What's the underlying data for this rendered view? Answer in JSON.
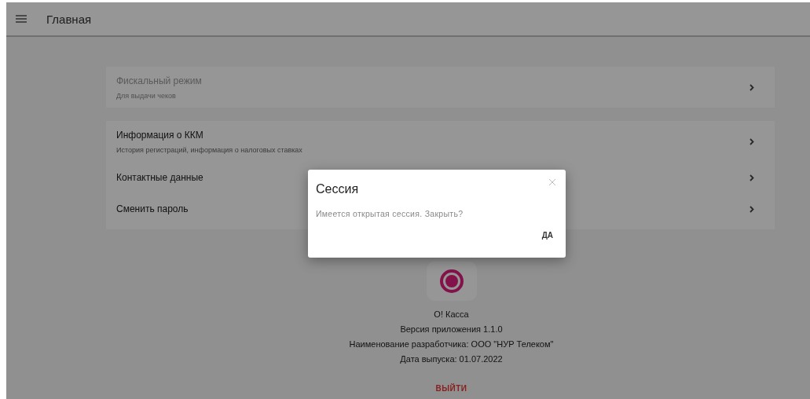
{
  "app_bar": {
    "title": "Главная"
  },
  "menu_groups": [
    {
      "items": [
        {
          "title": "Фискальный режим",
          "subtitle": "Для выдачи чеков",
          "disabled": true
        }
      ]
    },
    {
      "items": [
        {
          "title": "Информация о ККМ",
          "subtitle": "История регистраций, информация о налоговых ставках",
          "disabled": false
        },
        {
          "title": "Контактные данные",
          "disabled": false
        },
        {
          "title": "Сменить пароль",
          "disabled": false
        }
      ]
    }
  ],
  "about": {
    "app_name": "O! Касса",
    "version": "Версия приложения 1.1.0",
    "developer": "Наименование разработчика: ООО \"НУР Телеком\"",
    "release_date": "Дата выпуска: 01.07.2022"
  },
  "logout_button": "ВЫЙТИ",
  "dialog": {
    "title": "Сессия",
    "message": "Имеется открытая сессия. Закрыть?",
    "confirm_button": "ДА"
  }
}
